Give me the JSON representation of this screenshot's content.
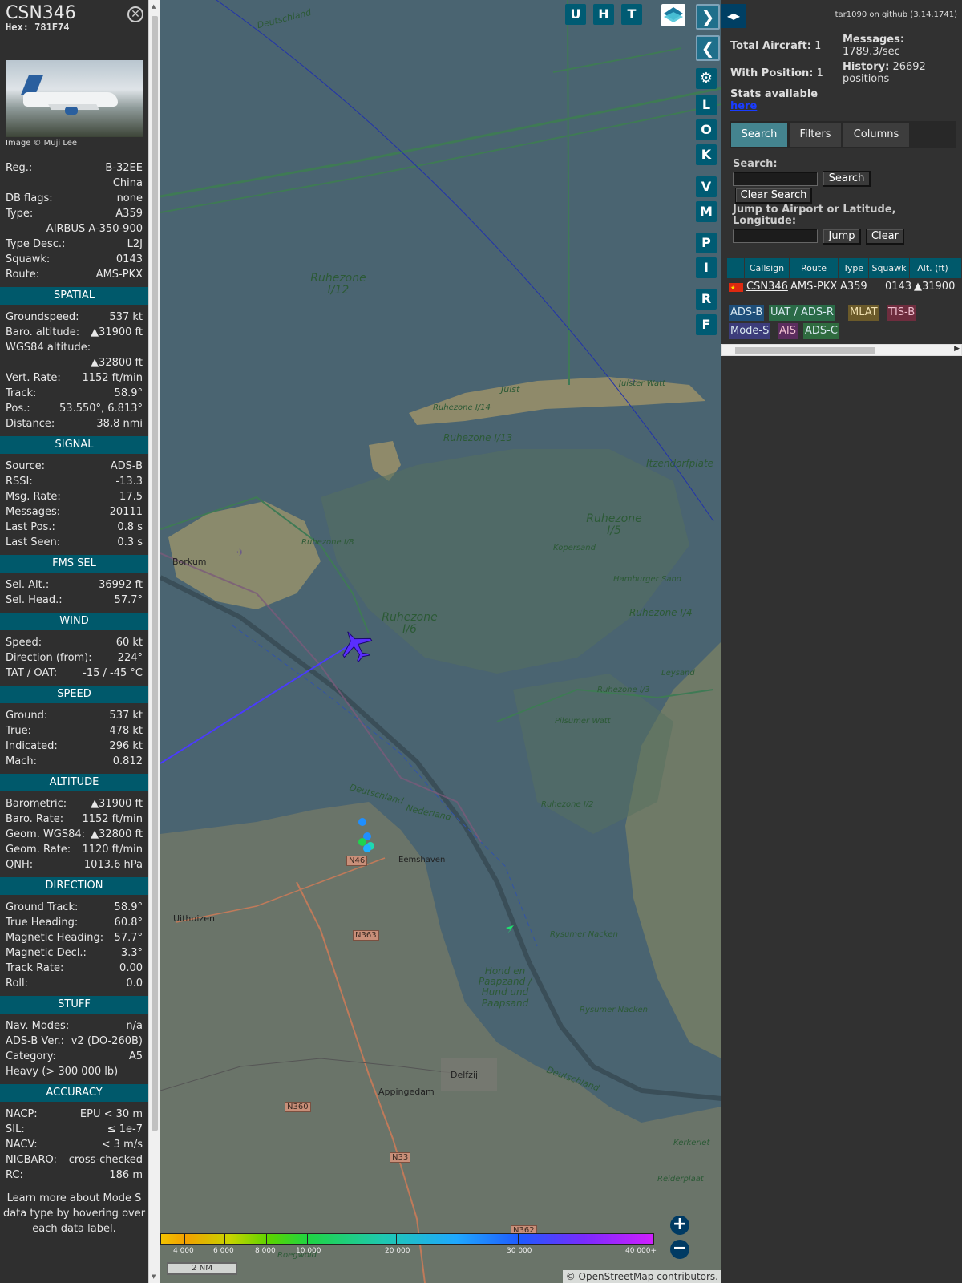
{
  "sidebar": {
    "callsign": "CSN346",
    "hex": "Hex: 781F74",
    "image_credit": "Image © Muji Lee",
    "top_rows": [
      {
        "k": "Reg.:",
        "v": "B-32EE"
      },
      {
        "k": "",
        "v": "China"
      },
      {
        "k": "DB flags:",
        "v": "none"
      },
      {
        "k": "Type:",
        "v": "A359"
      },
      {
        "k": "",
        "v": "AIRBUS A-350-900"
      },
      {
        "k": "Type Desc.:",
        "v": "L2J"
      },
      {
        "k": "Squawk:",
        "v": "0143"
      },
      {
        "k": "Route:",
        "v": "AMS-PKX"
      }
    ],
    "sections": [
      {
        "title": "SPATIAL",
        "rows": [
          {
            "k": "Groundspeed:",
            "v": "537 kt"
          },
          {
            "k": "Baro. altitude:",
            "v": "▲31900 ft"
          },
          {
            "k": "WGS84 altitude:",
            "v": ""
          },
          {
            "k": "",
            "v": "▲32800 ft"
          },
          {
            "k": "Vert. Rate:",
            "v": "1152 ft/min"
          },
          {
            "k": "Track:",
            "v": "58.9°"
          },
          {
            "k": "Pos.:",
            "v": "53.550°, 6.813°"
          },
          {
            "k": "Distance:",
            "v": "38.8 nmi"
          }
        ]
      },
      {
        "title": "SIGNAL",
        "rows": [
          {
            "k": "Source:",
            "v": "ADS-B"
          },
          {
            "k": "RSSI:",
            "v": "-13.3"
          },
          {
            "k": "Msg. Rate:",
            "v": "17.5"
          },
          {
            "k": "Messages:",
            "v": "20111"
          },
          {
            "k": "Last Pos.:",
            "v": "0.8 s"
          },
          {
            "k": "Last Seen:",
            "v": "0.3 s"
          }
        ]
      },
      {
        "title": "FMS SEL",
        "rows": [
          {
            "k": "Sel. Alt.:",
            "v": "36992 ft"
          },
          {
            "k": "Sel. Head.:",
            "v": "57.7°"
          }
        ]
      },
      {
        "title": "WIND",
        "rows": [
          {
            "k": "Speed:",
            "v": "60 kt"
          },
          {
            "k": "Direction (from):",
            "v": "224°"
          },
          {
            "k": "TAT / OAT:",
            "v": "-15 / -45 °C"
          }
        ]
      },
      {
        "title": "SPEED",
        "rows": [
          {
            "k": "Ground:",
            "v": "537 kt"
          },
          {
            "k": "True:",
            "v": "478 kt"
          },
          {
            "k": "Indicated:",
            "v": "296 kt"
          },
          {
            "k": "Mach:",
            "v": "0.812"
          }
        ]
      },
      {
        "title": "ALTITUDE",
        "rows": [
          {
            "k": "Barometric:",
            "v": "▲31900 ft"
          },
          {
            "k": "Baro. Rate:",
            "v": "1152 ft/min"
          },
          {
            "k": "Geom. WGS84:",
            "v": "▲32800 ft"
          },
          {
            "k": "Geom. Rate:",
            "v": "1120 ft/min"
          },
          {
            "k": "QNH:",
            "v": "1013.6 hPa"
          }
        ]
      },
      {
        "title": "DIRECTION",
        "rows": [
          {
            "k": "Ground Track:",
            "v": "58.9°"
          },
          {
            "k": "True Heading:",
            "v": "60.8°"
          },
          {
            "k": "Magnetic Heading:",
            "v": "57.7°"
          },
          {
            "k": "Magnetic Decl.:",
            "v": "3.3°"
          },
          {
            "k": "Track Rate:",
            "v": "0.00"
          },
          {
            "k": "Roll:",
            "v": "0.0"
          }
        ]
      },
      {
        "title": "STUFF",
        "rows": [
          {
            "k": "Nav. Modes:",
            "v": "n/a"
          },
          {
            "k": "ADS-B Ver.:",
            "v": "v2 (DO-260B)"
          },
          {
            "k": "Category:",
            "v": "A5"
          },
          {
            "k": "Heavy (> 300 000 lb)",
            "v": ""
          }
        ]
      },
      {
        "title": "ACCURACY",
        "rows": [
          {
            "k": "NACP:",
            "v": "EPU < 30 m"
          },
          {
            "k": "SIL:",
            "v": "≤ 1e-7"
          },
          {
            "k": "NACV:",
            "v": "< 3 m/s"
          },
          {
            "k": "NICBARO:",
            "v": "cross-checked"
          },
          {
            "k": "RC:",
            "v": "186 m"
          }
        ]
      }
    ],
    "footer": "Learn more about Mode S data type by hovering over each data label."
  },
  "map": {
    "buttons_top": [
      "U",
      "H",
      "T"
    ],
    "side_buttons": [
      "L",
      "O",
      "K",
      "V",
      "M",
      "P",
      "I",
      "R",
      "F"
    ],
    "labels": [
      {
        "t": "Deutschland"
      },
      {
        "t": "Ruhezone I/12"
      },
      {
        "t": "Juist"
      },
      {
        "t": "Juister Watt"
      },
      {
        "t": "Ruhezone I/14"
      },
      {
        "t": "Ruhezone I/13"
      },
      {
        "t": "Itzendorfplate"
      },
      {
        "t": "Ruhezone I/5"
      },
      {
        "t": "Kopersand"
      },
      {
        "t": "Borkum"
      },
      {
        "t": "Ruhezone I/8"
      },
      {
        "t": "Ruhezone I/6"
      },
      {
        "t": "Hamburger Sand"
      },
      {
        "t": "Ruhezone I/4"
      },
      {
        "t": "Leysand"
      },
      {
        "t": "Ruhezone I/3"
      },
      {
        "t": "Pilsumer Watt"
      },
      {
        "t": "Deutschland"
      },
      {
        "t": "Nederland"
      },
      {
        "t": "Ruhezone I/2"
      },
      {
        "t": "N46"
      },
      {
        "t": "Eemshaven"
      },
      {
        "t": "Uithuizen"
      },
      {
        "t": "N363"
      },
      {
        "t": "Rysumer Nacken"
      },
      {
        "t": "Hond en Paapzand / Hund und Paapsand"
      },
      {
        "t": "Rysumer Nacken"
      },
      {
        "t": "Delfzijl"
      },
      {
        "t": "Appingedam"
      },
      {
        "t": "Deutschland"
      },
      {
        "t": "N360"
      },
      {
        "t": "N33"
      },
      {
        "t": "Kerkeriet"
      },
      {
        "t": "Reiderplaat"
      },
      {
        "t": "N362"
      },
      {
        "t": "Roegwold"
      }
    ],
    "legend_ticks": [
      "4 000",
      "6 000",
      "8 000",
      "10 000",
      "20 000",
      "30 000",
      "40 000+"
    ],
    "scale": "2 NM",
    "attribution_prefix": "© ",
    "attribution_link": "OpenStreetMap",
    "attribution_suffix": " contributors."
  },
  "panel": {
    "github": "tar1090 on github (3.14.1741)",
    "total_aircraft_label": "Total Aircraft:",
    "total_aircraft": "1",
    "with_position_label": "With Position:",
    "with_position": "1",
    "messages_label": "Messages:",
    "messages_value": "1789.3/sec",
    "history_label": "History:",
    "history_value": "26692",
    "history_unit": "positions",
    "stats_label": "Stats available",
    "stats_link": "here",
    "tabs": [
      "Search",
      "Filters",
      "Columns"
    ],
    "search_label": "Search:",
    "search_button": "Search",
    "clear_search_button": "Clear Search",
    "jump_label": "Jump to Airport or Latitude, Longitude:",
    "jump_button": "Jump",
    "clear_button": "Clear",
    "table_headers": [
      "Callsign",
      "Route",
      "Type",
      "Squawk",
      "Alt. (ft)"
    ],
    "table_row": {
      "callsign": "CSN346",
      "route": "AMS-PKX",
      "type": "A359",
      "squawk": "0143",
      "alt": "▲31900"
    },
    "source_badges": [
      {
        "label": "ADS-B",
        "color": "#1f4f7a"
      },
      {
        "label": "UAT / ADS-R",
        "color": "#2a6b47"
      },
      {
        "label": "MLAT",
        "color": "#6b5a2a"
      },
      {
        "label": "TIS-B",
        "color": "#6e2d3e"
      },
      {
        "label": "Mode-S",
        "color": "#3c3c7a"
      },
      {
        "label": "AIS",
        "color": "#5b2d5e"
      },
      {
        "label": "ADS-C",
        "color": "#2f6b3f"
      }
    ]
  }
}
